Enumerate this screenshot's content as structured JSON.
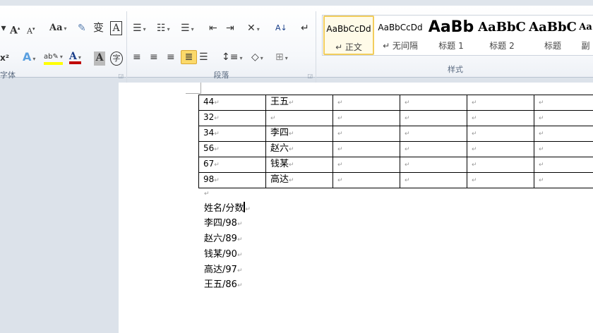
{
  "ribbon": {
    "groups": {
      "font": "字体",
      "paragraph": "段落",
      "styles": "样式"
    },
    "styles": [
      {
        "preview": "AaBbCcDd",
        "name": "↵ 正文",
        "selected": true
      },
      {
        "preview": "AaBbCcDd",
        "name": "↵ 无间隔"
      },
      {
        "preview": "AaBb",
        "name": "标题 1"
      },
      {
        "preview": "AaBbC",
        "name": "标题 2"
      },
      {
        "preview": "AaBbC",
        "name": "标题"
      },
      {
        "preview": "Aa",
        "name": "副"
      }
    ],
    "active_alignment": "justify",
    "colors": {
      "highlight": "#ffff00",
      "font_color": "#c00000",
      "selected": "#fbd96a"
    }
  },
  "table": {
    "rows": [
      [
        "44",
        "王五",
        "",
        "",
        "",
        ""
      ],
      [
        "32",
        "",
        "",
        "",
        "",
        ""
      ],
      [
        "34",
        "李四",
        "",
        "",
        "",
        ""
      ],
      [
        "56",
        "赵六",
        "",
        "",
        "",
        ""
      ],
      [
        "67",
        "钱某",
        "",
        "",
        "",
        ""
      ],
      [
        "98",
        "高达",
        "",
        "",
        "",
        ""
      ]
    ]
  },
  "lines": [
    "姓名/分数",
    "李四/98",
    "赵六/89",
    "钱某/90",
    "高达/97",
    "王五/86"
  ]
}
